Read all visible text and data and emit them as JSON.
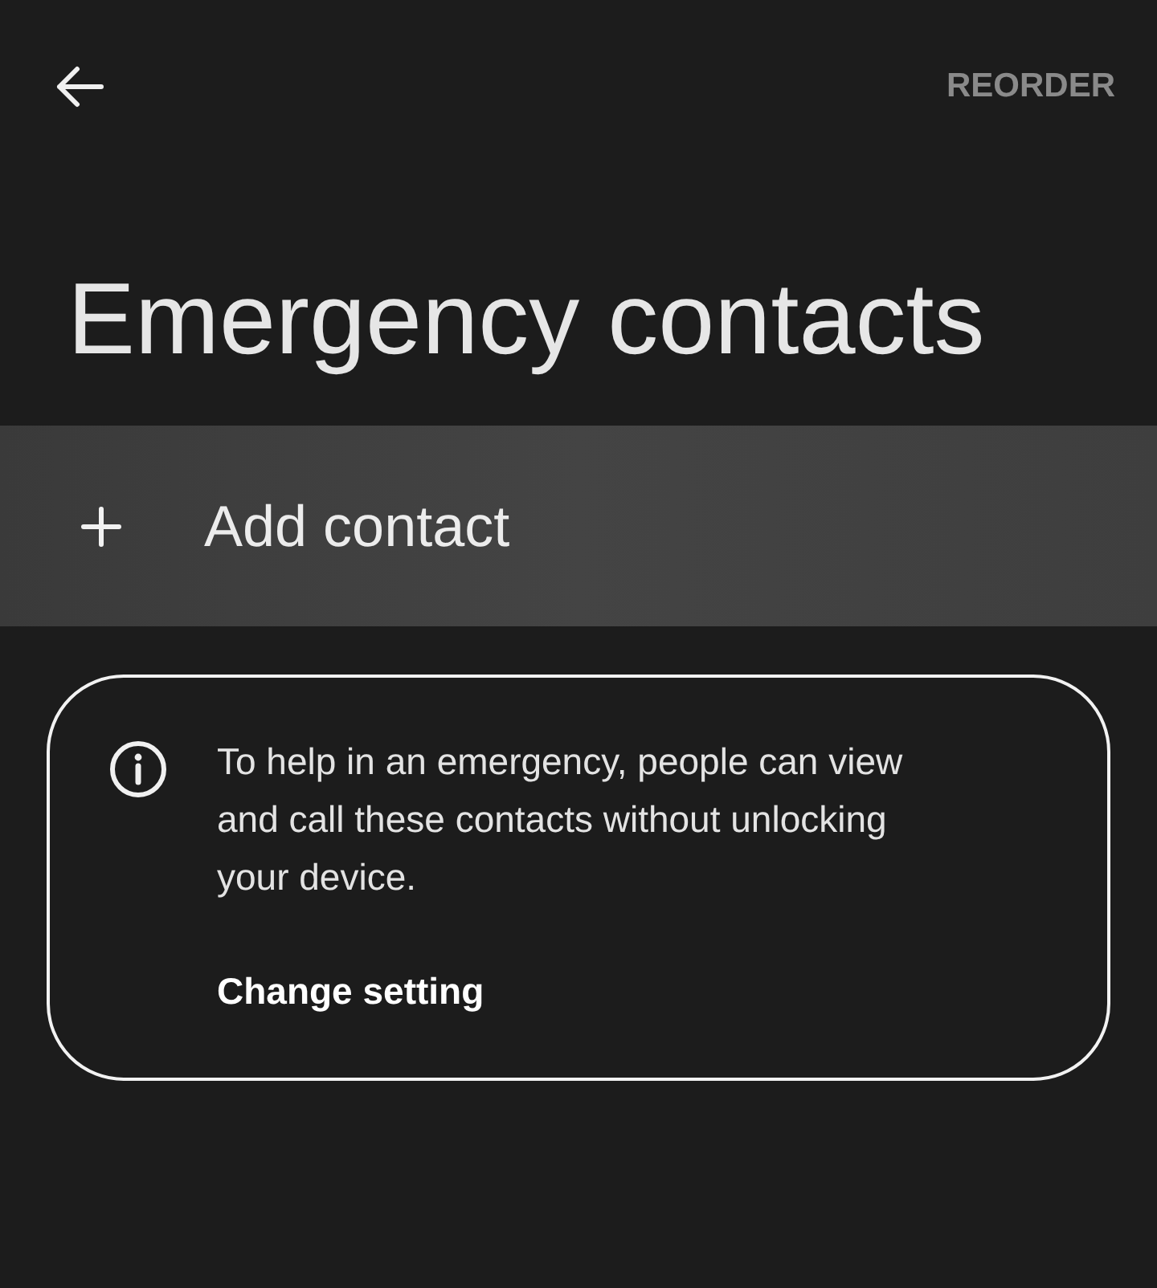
{
  "toolbar": {
    "reorder": {
      "label": "REORDER",
      "disabled": true
    }
  },
  "title": "Emergency contacts",
  "add_contact": {
    "label": "Add contact"
  },
  "info_card": {
    "message": "To help in an emergency, people can view and call these contacts without unlocking your device.",
    "link": "Change setting"
  }
}
